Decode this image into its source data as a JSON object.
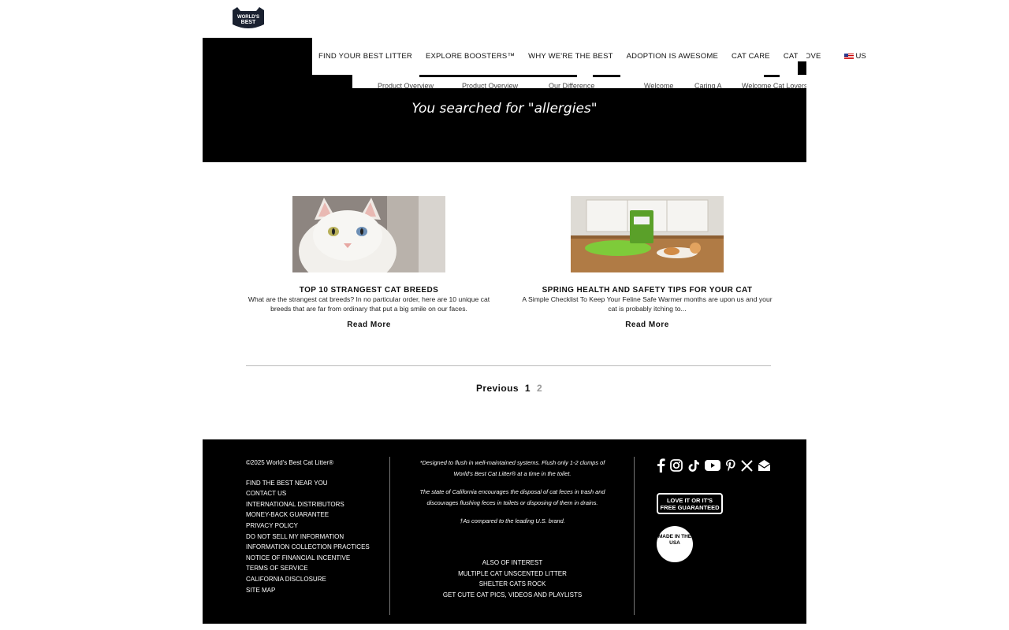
{
  "brand": {
    "logo_text": "WORLD'S BEST CAT LITTER"
  },
  "nav": {
    "items": [
      "Find Your Best Litter",
      "Explore Boosters™",
      "Why We're the Best",
      "Adoption is Awesome",
      "Cat Care",
      "Cat Love"
    ],
    "region": "US"
  },
  "subnav": [
    "Product Overview",
    "Product Overview",
    "Our Difference",
    "Welcome",
    "Caring A",
    "Welcome Cat Lovers"
  ],
  "search": {
    "heading": "You searched for \"allergies\""
  },
  "articles": [
    {
      "title": "Top 10 Strangest Cat Breeds",
      "excerpt": "What are the strangest cat breeds? In no particular order, here are 10 unique cat breeds that are far from ordinary that put a big smile on our faces.",
      "cta": "Read More"
    },
    {
      "title": "Spring Health and Safety Tips for Your Cat",
      "excerpt": "A Simple Checklist To Keep Your Feline Safe Warmer months are upon us and your cat is probably itching to...",
      "cta": "Read More"
    }
  ],
  "pagination": {
    "previous": "Previous",
    "current": "1",
    "next": "2"
  },
  "footer": {
    "copyright": "©2025 World's Best Cat Litter®",
    "links": [
      "Find the Best Near You",
      "Contact Us",
      "International Distributors",
      "Money-Back Guarantee",
      "Privacy Policy",
      "Do Not Sell My Information",
      "Information Collection Practices",
      "Notice of Financial Incentive",
      "Terms of Service",
      "California Disclosure",
      "Site Map"
    ],
    "disclaimer1": "*Designed to flush in well-maintained systems. Flush only 1-2 clumps of World's Best Cat Litter® at a time in the toilet.",
    "disclaimer2": "The state of California encourages the disposal of cat feces in trash and discourages flushing feces in toilets or disposing of them in drains.",
    "disclaimer3": "†As compared to the leading U.S. brand.",
    "also_heading": "Also of Interest",
    "also_links": [
      "Multiple Cat Unscented Litter",
      "Shelter Cats Rock",
      "Get Cute Cat Pics, Videos and Playlists"
    ],
    "badge_guarantee": "LOVE IT OR IT'S FREE GUARANTEED",
    "badge_usa": "MADE IN THE USA",
    "social_icons": [
      "facebook-icon",
      "instagram-icon",
      "tiktok-icon",
      "youtube-icon",
      "pinterest-icon",
      "x-icon",
      "email-icon"
    ]
  },
  "colors": {
    "black": "#000000",
    "white": "#ffffff",
    "divider": "#bbbbbb"
  }
}
